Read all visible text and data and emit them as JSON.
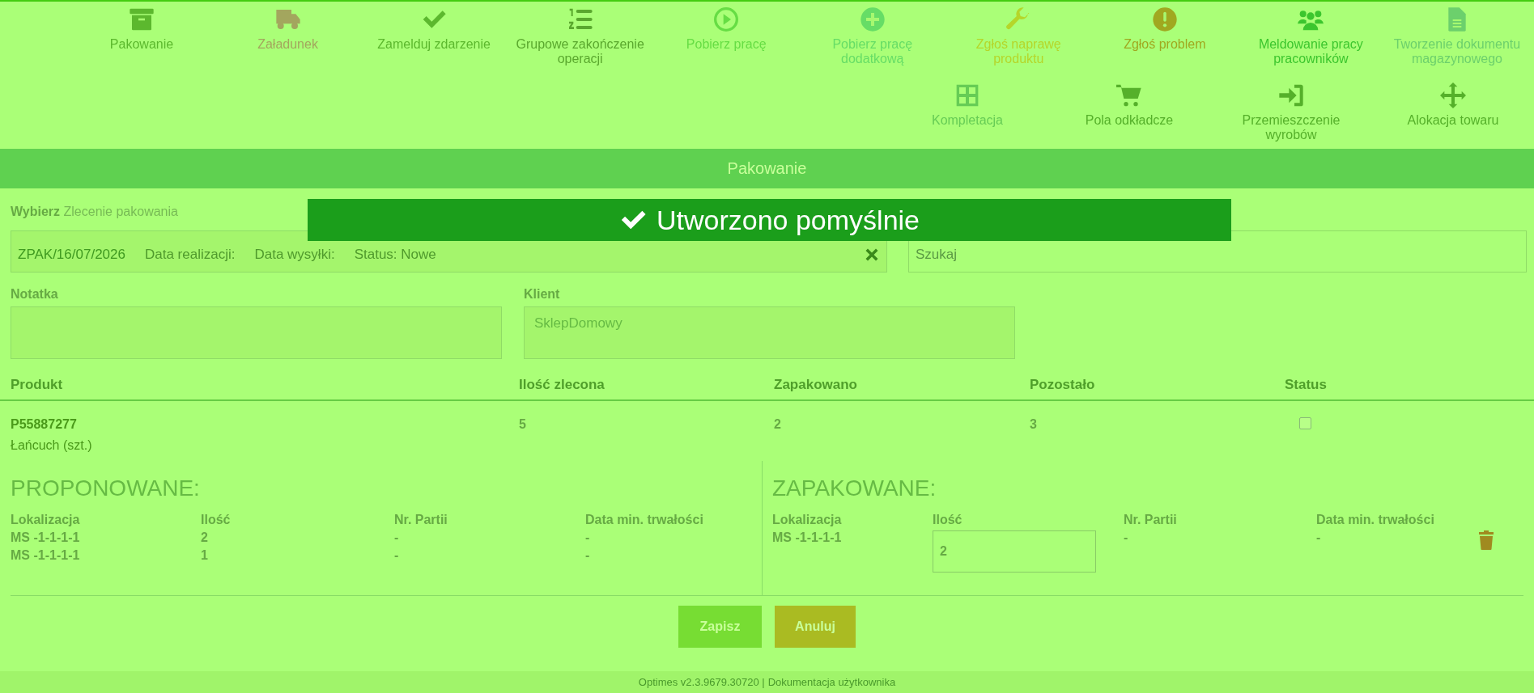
{
  "toolbar": {
    "rows": [
      {
        "items": [
          {
            "label": "Pakowanie",
            "color": "#5cb82e"
          },
          {
            "label": "Załadunek",
            "color": "#a3a65e"
          },
          {
            "label": "Zamelduj zdarzenie",
            "color": "#5cb82e"
          },
          {
            "label": "Grupowe zakończenie operacji",
            "color": "#5aa82e"
          },
          {
            "label": "Pobierz pracę",
            "color": "#66dd44"
          },
          {
            "label": "Pobierz pracę dodatkową",
            "color": "#66dd66"
          },
          {
            "label": "Zgłoś naprawę produktu",
            "color": "#b5d62a"
          },
          {
            "label": "Zgłoś problem",
            "color": "#a0a820"
          },
          {
            "label": "Meldowanie pracy pracowników",
            "color": "#3cc62e"
          },
          {
            "label": "Tworzenie dokumentu magazynowego",
            "color": "#6cd06c"
          }
        ]
      },
      {
        "items": [
          {
            "label": "Kompletacja",
            "color": "#66cc55"
          },
          {
            "label": "Pola odkładcze",
            "color": "#55b02a"
          },
          {
            "label": "Przemieszczenie wyrobów",
            "color": "#55b02a"
          },
          {
            "label": "Alokacja towaru",
            "color": "#55b02a"
          }
        ]
      }
    ]
  },
  "header": {
    "title": "Pakowanie"
  },
  "toast": {
    "message": "Utworzono pomyślnie"
  },
  "order": {
    "label_bold": "Wybierz",
    "label": "Zlecenie pakowania",
    "number": "ZPAK/16/07/2026",
    "fields": [
      "Data realizacji:",
      "Data wysyłki:",
      "Status: Nowe"
    ]
  },
  "search": {
    "placeholder": "Szukaj"
  },
  "note": {
    "label": "Notatka"
  },
  "client": {
    "label": "Klient",
    "value": "SklepDomowy"
  },
  "table": {
    "columns": [
      "Produkt",
      "Ilość zlecona",
      "Zapakowano",
      "Pozostało",
      "Status"
    ],
    "rows": [
      {
        "code": "P55887277",
        "name": "Łańcuch (szt.)",
        "ordered": "5",
        "packed": "2",
        "remaining": "3",
        "checked": false
      }
    ]
  },
  "proposed": {
    "title": "PROPONOWANE:",
    "columns": [
      "Lokalizacja",
      "Ilość",
      "Nr. Partii",
      "Data min. trwałości"
    ],
    "rows": [
      [
        "MS -1-1-1-1",
        "2",
        "-",
        "-"
      ],
      [
        "MS -1-1-1-1",
        "1",
        "-",
        "-"
      ]
    ]
  },
  "packed": {
    "title": "ZAPAKOWANE:",
    "columns": [
      "Lokalizacja",
      "Ilość",
      "Nr. Partii",
      "Data min. trwałości"
    ],
    "rows": [
      {
        "location": "MS -1-1-1-1",
        "quantity": "2",
        "batch": "-",
        "date": "-"
      }
    ]
  },
  "buttons": [
    {
      "label": "Zapisz",
      "kind": "save"
    },
    {
      "label": "Anuluj",
      "kind": "cancel"
    }
  ],
  "footer": {
    "version": "Optimes v2.3.9679.30720 |",
    "link": "Dokumentacja użytkownika"
  }
}
